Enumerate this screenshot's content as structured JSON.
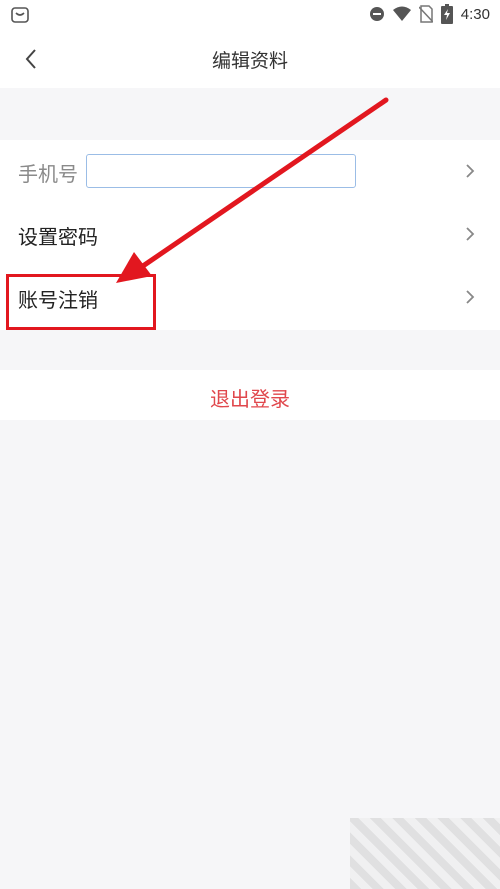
{
  "status_bar": {
    "time": "4:30",
    "icons": [
      "shopping-bag-icon",
      "do-not-disturb-icon",
      "wifi-icon",
      "no-sim-icon",
      "battery-charging-icon"
    ]
  },
  "header": {
    "title": "编辑资料",
    "back_icon": "back-chevron-icon"
  },
  "profile_rows": [
    {
      "label": "手机号",
      "input_value": "",
      "input_placeholder": ""
    },
    {
      "label": "设置密码"
    },
    {
      "label": "账号注销"
    }
  ],
  "logout": {
    "label": "退出登录"
  },
  "colors": {
    "background": "#f6f6f8",
    "card": "#ffffff",
    "logout_text": "#e0474c",
    "annotation_red": "#e2171f",
    "input_border": "#9bbde6"
  }
}
